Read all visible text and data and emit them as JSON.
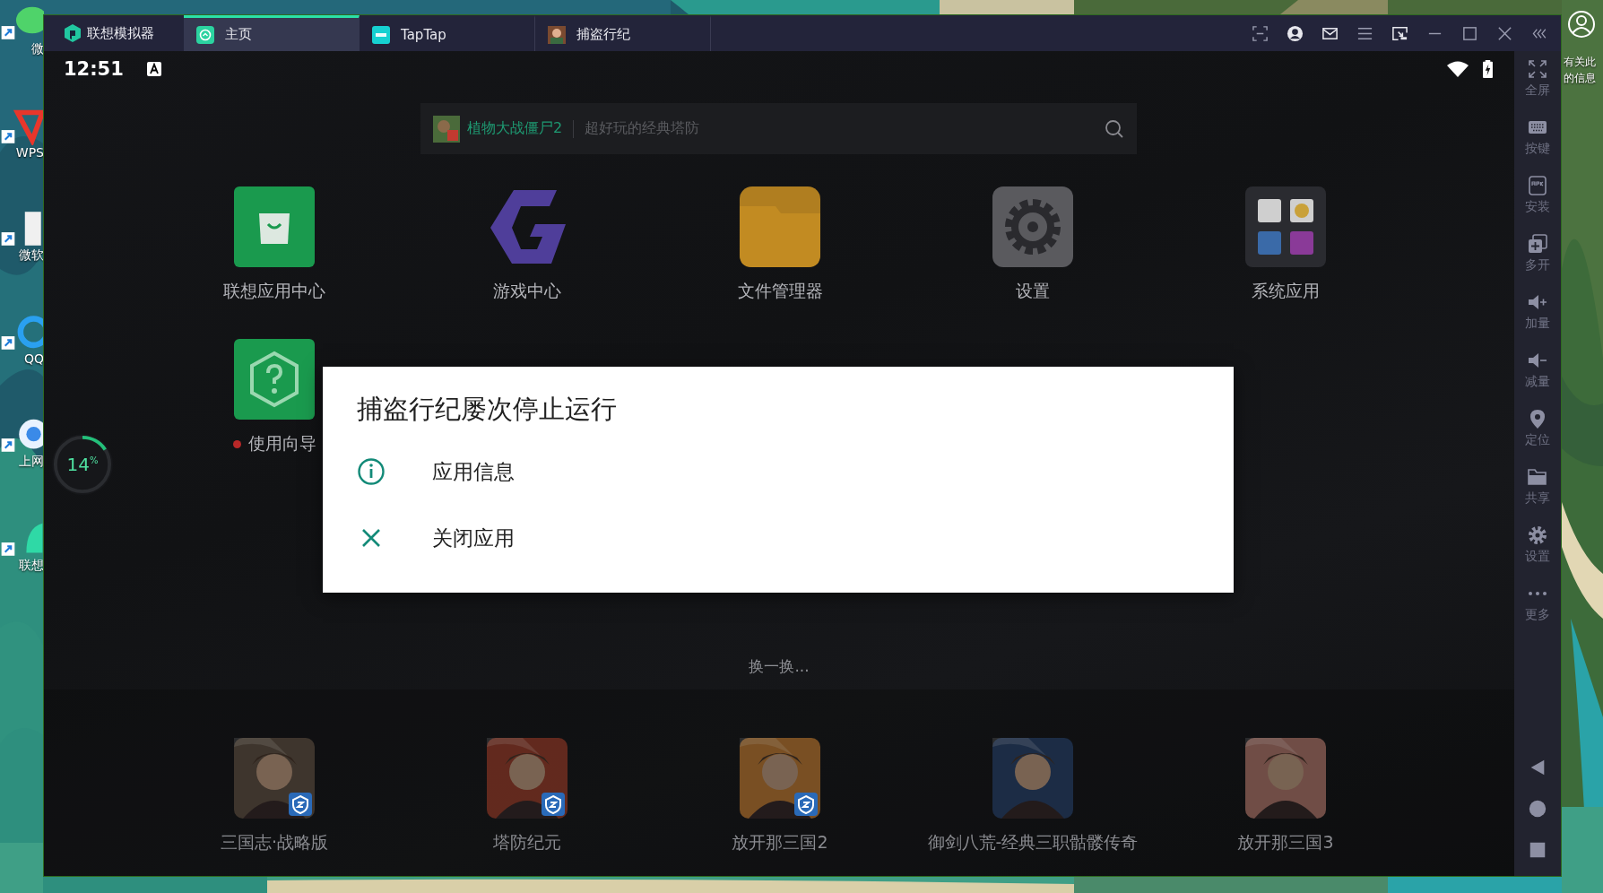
{
  "desktop": {
    "left_icons": [
      {
        "label": "微",
        "kind": "chat"
      },
      {
        "label": "WPS",
        "kind": "wps"
      },
      {
        "label": "微软",
        "kind": "doc"
      },
      {
        "label": "QQ",
        "kind": "browser"
      },
      {
        "label": "上网",
        "kind": "globe"
      },
      {
        "label": "联想",
        "kind": "lenovo"
      }
    ],
    "right_note": [
      "有关此",
      "的信息"
    ]
  },
  "window": {
    "app_name": "联想模拟器",
    "tabs": [
      {
        "label": "主页",
        "kind": "home",
        "selected": true
      },
      {
        "label": "TapTap",
        "kind": "taptap",
        "selected": false
      },
      {
        "label": "捕盗行纪",
        "kind": "game",
        "selected": false
      }
    ]
  },
  "status_bar": {
    "time": "12:51"
  },
  "search": {
    "featured": "植物大战僵尸2",
    "placeholder": "超好玩的经典塔防"
  },
  "apps": [
    {
      "label": "联想应用中心",
      "kind": "store",
      "badge": false
    },
    {
      "label": "游戏中心",
      "kind": "games",
      "badge": false
    },
    {
      "label": "文件管理器",
      "kind": "files",
      "badge": false
    },
    {
      "label": "设置",
      "kind": "settings",
      "badge": false
    },
    {
      "label": "系统应用",
      "kind": "folder",
      "badge": false
    },
    {
      "label": "使用向导",
      "kind": "help",
      "badge": true
    }
  ],
  "floating_ball": {
    "reading": "14$^{%}$"
  },
  "dialog": {
    "title": "捕盗行纪屡次停止运行",
    "options": [
      {
        "label": "应用信息",
        "kind": "info"
      },
      {
        "label": "关闭应用",
        "kind": "close"
      }
    ]
  },
  "refresh_label": "换一换...",
  "recommended": [
    {
      "label": "三国志·战略版",
      "verified": true
    },
    {
      "label": "塔防纪元",
      "verified": true
    },
    {
      "label": "放开那三国2",
      "verified": true
    },
    {
      "label": "御剑八荒-经典三职骷髅传奇",
      "verified": false
    },
    {
      "label": "放开那三国3",
      "verified": false
    }
  ],
  "sidebar": [
    {
      "label": "全屏",
      "kind": "fullscreen"
    },
    {
      "label": "按键",
      "kind": "keyboard"
    },
    {
      "label": "安装",
      "kind": "apk"
    },
    {
      "label": "多开",
      "kind": "multi"
    },
    {
      "label": "加量",
      "kind": "volup"
    },
    {
      "label": "减量",
      "kind": "voldown"
    },
    {
      "label": "定位",
      "kind": "location"
    },
    {
      "label": "共享",
      "kind": "share"
    },
    {
      "label": "设置",
      "kind": "settings"
    },
    {
      "label": "更多",
      "kind": "more"
    }
  ]
}
